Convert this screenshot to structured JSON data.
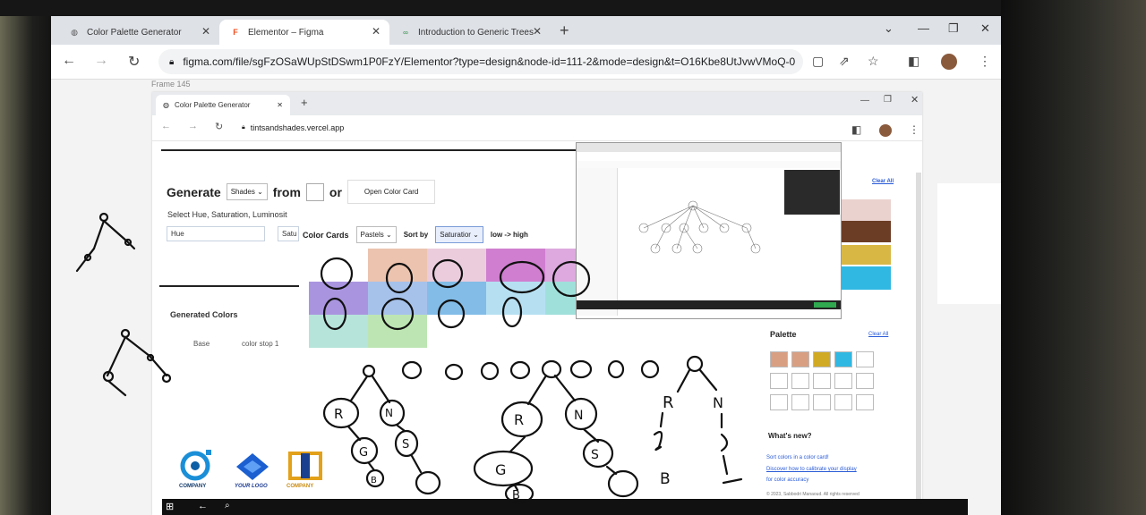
{
  "browser": {
    "tabs": [
      {
        "label": "Color Palette Generator"
      },
      {
        "label": "Elementor – Figma"
      },
      {
        "label": "Introduction to Generic Trees"
      }
    ],
    "url": "figma.com/file/sgFzOSaWUpStDSwm1P0FzY/Elementor?type=design&node-id=111-2&mode=design&t=O16Kbe8UtJvwVMoQ-0"
  },
  "figma": {
    "frame_label": "Frame 145",
    "inner_tab": "Color Palette Generator",
    "inner_url": "tintsandshades.vercel.app",
    "generate": {
      "label": "Generate",
      "select": "Shades",
      "from": "from",
      "or": "or",
      "button": "Open Color Card"
    },
    "select_hint": "Select Hue, Saturation, Luminosit",
    "hue_field": "Hue",
    "satu_field": "Satu",
    "color_cards": {
      "label": "Color Cards",
      "select": "Pastels",
      "sort_by": "Sort by",
      "sort_select": "Saturatior",
      "order": "low -> high"
    },
    "generated_colors": "Generated Colors",
    "base": "Base",
    "color_stop": "color stop 1",
    "palette": "Palette",
    "clear_all": "Clear All",
    "clear_all_2": "Clear All",
    "whats_new": "What's new?",
    "news_1": "Sort colors in a color card!",
    "news_2": "Discover how to calibrate your display",
    "news_3": "for color accuracy",
    "copyright": "© 2023, Sabbodri Manaoud. All rights reserved",
    "logos": [
      "COMPANY",
      "YOUR LOGO",
      "COMPANY"
    ]
  },
  "colors": {
    "pastel_row1": [
      "#ffffff",
      "#e9b8a0",
      "#e7c3d7",
      "#c867c8",
      "#d79ad8"
    ],
    "pastel_row2": [
      "#9a83d9",
      "#97b7e8",
      "#6cb0e3",
      "#a9daf0",
      "#8fdbd5"
    ],
    "pastel_row3": [
      "#a9dfd3",
      "#b2e0a6"
    ],
    "palette_swatches": [
      "#d99f82",
      "#d99f82",
      "#d1aa25",
      "#31b8e2"
    ],
    "right_swatches": [
      "#ead2cf",
      "#6b3d25",
      "#d1aa25",
      "#31b8e2"
    ]
  }
}
